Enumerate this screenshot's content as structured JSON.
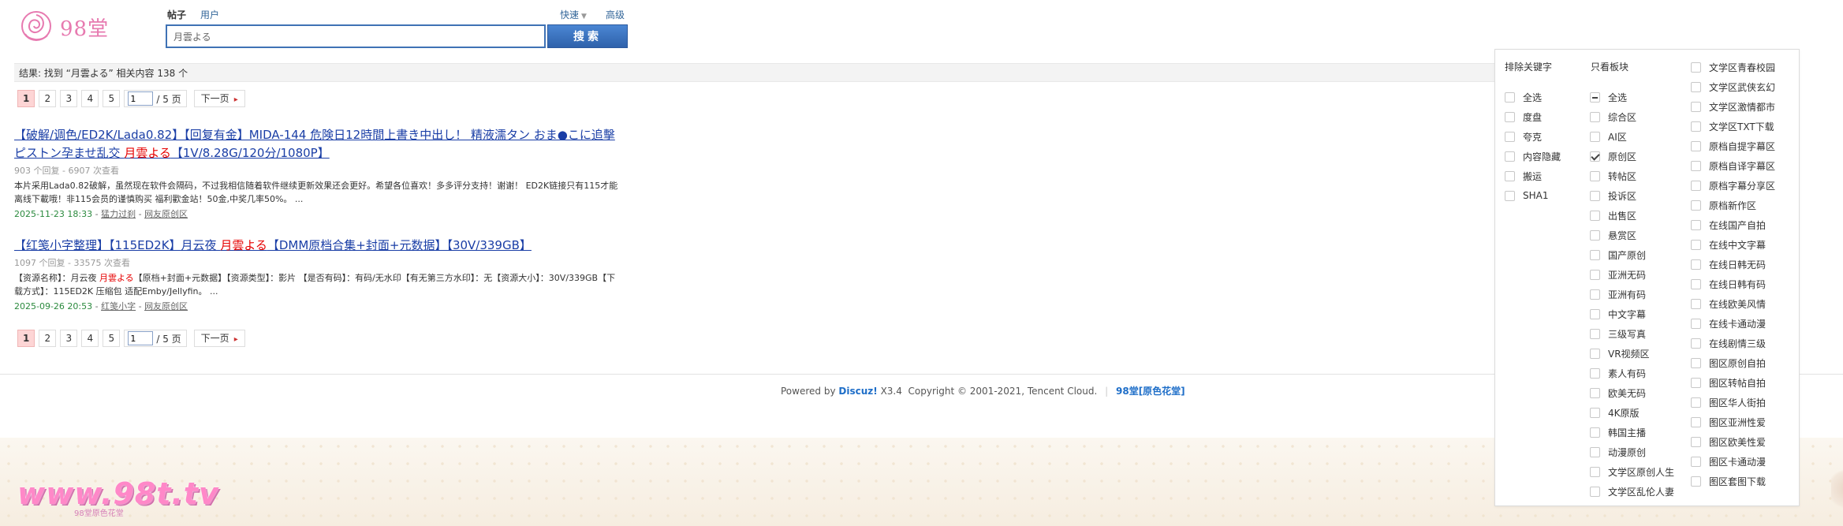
{
  "site": {
    "name": "98堂",
    "watermark": "www.98t.tv",
    "watermark_sub": "98堂原色花堂"
  },
  "search": {
    "tabs": [
      {
        "label": "帖子",
        "active": true
      },
      {
        "label": "用户",
        "active": false
      }
    ],
    "quick_label": "快速",
    "advanced_label": "高级",
    "query": "月雲よる",
    "button_label": "搜索"
  },
  "results_summary": "结果: 找到 “月雲よる” 相关内容 138 个",
  "pager": {
    "pages": [
      "1",
      "2",
      "3",
      "4",
      "5"
    ],
    "current": "1",
    "jump_value": "1",
    "total_label": "/ 5 页",
    "next_label": "下一页"
  },
  "results": [
    {
      "title_before": "【破解/调色/ED2K/Lada0.82】【回复有金】MIDA-144 危険日12時間上書き中出し！ 精液濡タン おま●こに追擊ピストン孕ませ乱交 ",
      "title_highlight": "月雲よる",
      "title_after": "【1V/8.28G/120分/1080P】",
      "meta": "903 个回复 - 6907 次查看",
      "snippet_before": "本片采用Lada0.82破解，虽然现在软件会隔码，不过我相信随着软件继续更新效果还会更好。希望各位喜欢！多多评分支持！谢谢！ ED2K链接只有115才能离线下載哦！非115会员的谨慎购买 福利歡金站！50金,中奖几率50%。 ...",
      "snippet_highlight": "",
      "snippet_after": "",
      "date": "2025-11-23 18:33",
      "author": "猛力过刹",
      "forum": "网友原创区"
    },
    {
      "title_before": "【红笺小字整理】【115ED2K】月云夜 ",
      "title_highlight": "月雲よる",
      "title_after": "【DMM原档合集+封面+元数据】【30V/339GB】",
      "meta": "1097 个回复 - 33575 次查看",
      "snippet_before": "【资源名称】：月云夜 ",
      "snippet_highlight": "月雲よる",
      "snippet_after": "【原档+封面+元数据】【资源类型】：影片 【是否有码】：有码/无水印【有无第三方水印】：无【资源大小】：30V/339GB【下载方式】：115ED2K 压缩包 适配Emby/Jellyfin。 ...",
      "date": "2025-09-26 20:53",
      "author": "红笺小字",
      "forum": "网友原创区"
    }
  ],
  "footer": {
    "powered_by": "Powered by",
    "discuz": "Discuz!",
    "version": "X3.4",
    "copyright": "Copyright © 2001-2021, Tencent Cloud.",
    "separator": "|",
    "site_link": "98堂[原色花堂]"
  },
  "filter_panel": {
    "exclude_header": "排除关键字",
    "only_header": "只看板块",
    "exclude_items": [
      {
        "label": "全选",
        "state": "unchecked"
      },
      {
        "label": "度盘",
        "state": "unchecked"
      },
      {
        "label": "夸克",
        "state": "unchecked"
      },
      {
        "label": "内容隐藏",
        "state": "unchecked"
      },
      {
        "label": "搬运",
        "state": "unchecked"
      },
      {
        "label": "SHA1",
        "state": "unchecked"
      }
    ],
    "forum_items": [
      {
        "label": "全选",
        "state": "indeterminate"
      },
      {
        "label": "综合区",
        "state": "unchecked"
      },
      {
        "label": "AI区",
        "state": "unchecked"
      },
      {
        "label": "原创区",
        "state": "checked"
      },
      {
        "label": "转帖区",
        "state": "unchecked"
      },
      {
        "label": "投诉区",
        "state": "unchecked"
      },
      {
        "label": "出售区",
        "state": "unchecked"
      },
      {
        "label": "悬赏区",
        "state": "unchecked"
      },
      {
        "label": "国产原创",
        "state": "unchecked"
      },
      {
        "label": "亚洲无码",
        "state": "unchecked"
      },
      {
        "label": "亚洲有码",
        "state": "unchecked"
      },
      {
        "label": "中文字幕",
        "state": "unchecked"
      },
      {
        "label": "三级写真",
        "state": "unchecked"
      },
      {
        "label": "VR视频区",
        "state": "unchecked"
      },
      {
        "label": "素人有码",
        "state": "unchecked"
      },
      {
        "label": "欧美无码",
        "state": "unchecked"
      },
      {
        "label": "4K原版",
        "state": "unchecked"
      },
      {
        "label": "韩国主播",
        "state": "unchecked"
      },
      {
        "label": "动漫原创",
        "state": "unchecked"
      },
      {
        "label": "文学区原创人生",
        "state": "unchecked"
      },
      {
        "label": "文学区乱伦人妻",
        "state": "unchecked"
      }
    ],
    "forum_items_col3": [
      {
        "label": "文学区青春校园",
        "state": "unchecked"
      },
      {
        "label": "文学区武侠玄幻",
        "state": "unchecked"
      },
      {
        "label": "文学区激情都市",
        "state": "unchecked"
      },
      {
        "label": "文学区TXT下载",
        "state": "unchecked"
      },
      {
        "label": "原档自提字幕区",
        "state": "unchecked"
      },
      {
        "label": "原档自译字幕区",
        "state": "unchecked"
      },
      {
        "label": "原档字幕分享区",
        "state": "unchecked"
      },
      {
        "label": "原档新作区",
        "state": "unchecked"
      },
      {
        "label": "在线国产自拍",
        "state": "unchecked"
      },
      {
        "label": "在线中文字幕",
        "state": "unchecked"
      },
      {
        "label": "在线日韩无码",
        "state": "unchecked"
      },
      {
        "label": "在线日韩有码",
        "state": "unchecked"
      },
      {
        "label": "在线欧美风情",
        "state": "unchecked"
      },
      {
        "label": "在线卡通动漫",
        "state": "unchecked"
      },
      {
        "label": "在线剧情三级",
        "state": "unchecked"
      },
      {
        "label": "图区原创自拍",
        "state": "unchecked"
      },
      {
        "label": "图区转帖自拍",
        "state": "unchecked"
      },
      {
        "label": "图区华人街拍",
        "state": "unchecked"
      },
      {
        "label": "图区亚洲性爱",
        "state": "unchecked"
      },
      {
        "label": "图区欧美性爱",
        "state": "unchecked"
      },
      {
        "label": "图区卡通动漫",
        "state": "unchecked"
      },
      {
        "label": "图区套图下载",
        "state": "unchecked"
      }
    ]
  }
}
